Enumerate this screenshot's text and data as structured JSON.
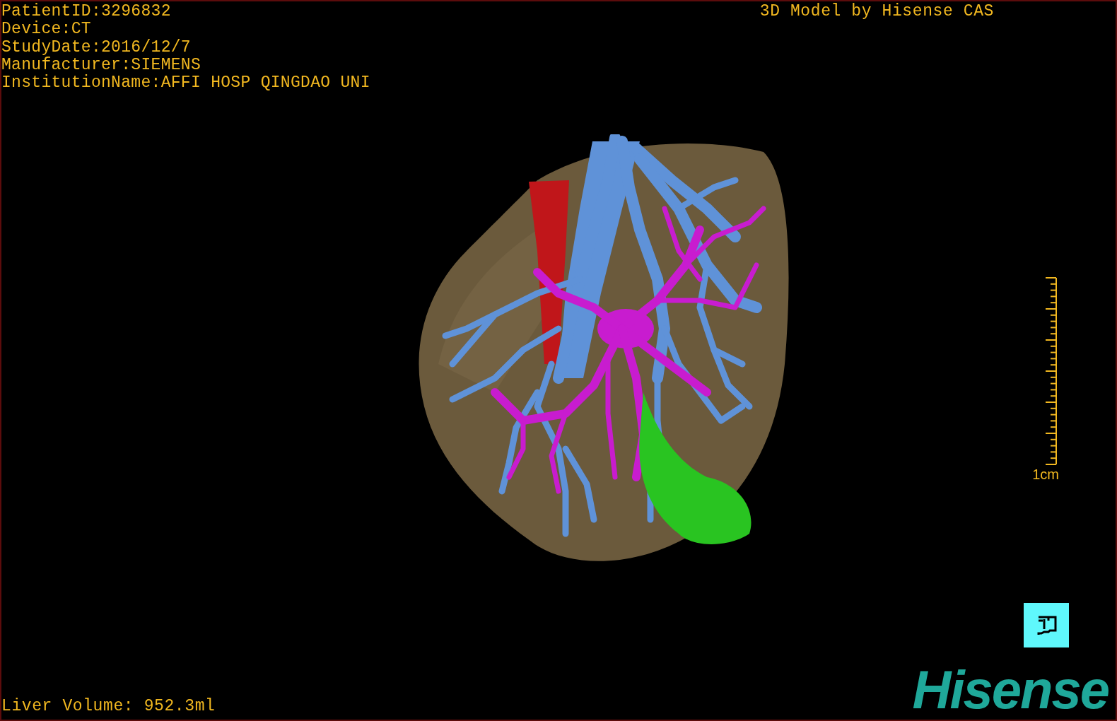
{
  "patient_info": [
    "PatientID:3296832",
    "Device:CT",
    "StudyDate:2016/12/7",
    "Manufacturer:SIEMENS",
    "InstitutionName:AFFI HOSP QINGDAO UNI"
  ],
  "title": "3D Model by Hisense CAS",
  "scale_bar": {
    "label": "1cm"
  },
  "liver_volume": "Liver Volume: 952.3ml",
  "logo": "Hisense"
}
